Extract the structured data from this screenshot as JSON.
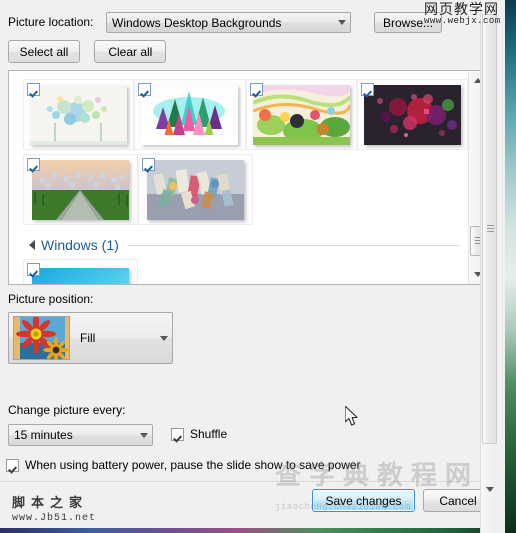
{
  "dialog": {
    "picture_location_label": "Picture location:",
    "picture_location_value": "Windows Desktop Backgrounds",
    "browse_label": "Browse...",
    "select_all_label": "Select all",
    "clear_all_label": "Clear all",
    "picture_position_label": "Picture position:",
    "picture_position_value": "Fill",
    "change_every_label": "Change picture every:",
    "change_every_value": "15 minutes",
    "shuffle_label": "Shuffle",
    "shuffle_checked": true,
    "battery_label": "When using battery power, pause the slide show to save power",
    "battery_checked": true,
    "save_label": "Save changes",
    "cancel_label": "Cancel"
  },
  "thumbnails": {
    "group_label": "Windows (1)",
    "row1": [
      {
        "name": "harmony-1",
        "checked": true
      },
      {
        "name": "harmony-2",
        "checked": true
      },
      {
        "name": "harmony-3",
        "checked": true
      },
      {
        "name": "harmony-4",
        "checked": true
      }
    ],
    "row2": [
      {
        "name": "harmony-5",
        "checked": true
      },
      {
        "name": "harmony-6",
        "checked": true
      }
    ],
    "windows_group": [
      {
        "name": "windows-logo",
        "checked": true
      }
    ]
  },
  "icons": {
    "combo_arrow": "chevron-down-icon",
    "group_expander": "triangle-collapse-icon",
    "scroll_up": "scroll-up-arrow-icon",
    "scroll_down": "scroll-down-arrow-icon"
  },
  "watermarks": {
    "webjx_cn": "网页教学网",
    "webjx_en": "www.webjx.com",
    "jb51_cn": "脚本之家",
    "jb51_en": "www.Jb51.net",
    "chazidian_cn": "查字典教程网",
    "chazidian_en": "jiaocheng.chazidian.com"
  },
  "colors": {
    "accent": "#3c8dde",
    "group_header": "#1f5b8f",
    "window_bg": "#f0f0f0",
    "list_bg": "#ffffff"
  }
}
